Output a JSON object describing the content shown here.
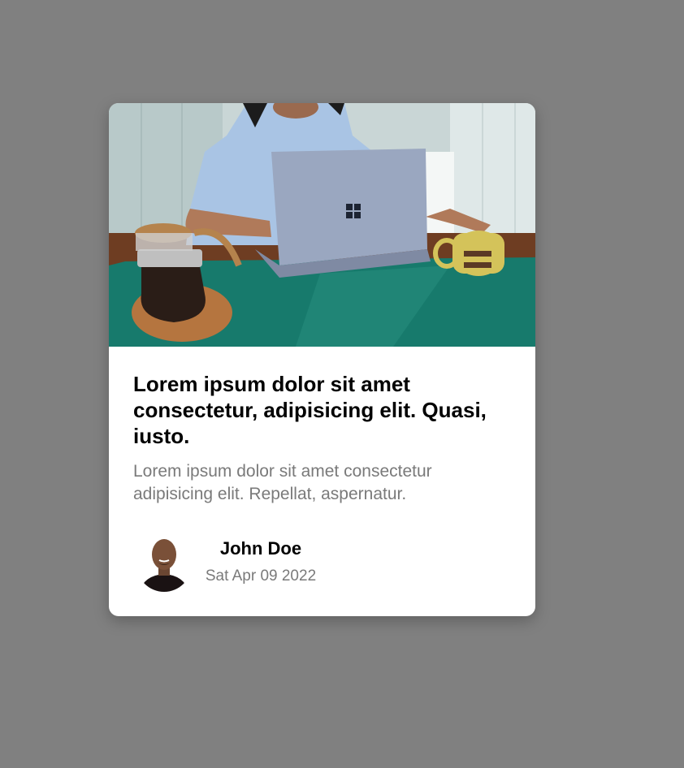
{
  "card": {
    "image_subject": "person-with-laptop-coffee-icon",
    "title": "Lorem ipsum dolor sit amet consectetur, adipisicing elit. Quasi, iusto.",
    "description": "Lorem ipsum dolor sit amet consectetur adipisicing elit. Repellat, aspernatur.",
    "author": {
      "name": "John Doe",
      "date": "Sat Apr 09 2022",
      "avatar_icon": "person-avatar-icon"
    }
  },
  "colors": {
    "background": "#808080",
    "card": "#ffffff",
    "title": "#000000",
    "muted_text": "#7a7a7a",
    "table_cloth": "#177a6c",
    "laptop": "#9aa7c0",
    "mug": "#d4c35a"
  }
}
